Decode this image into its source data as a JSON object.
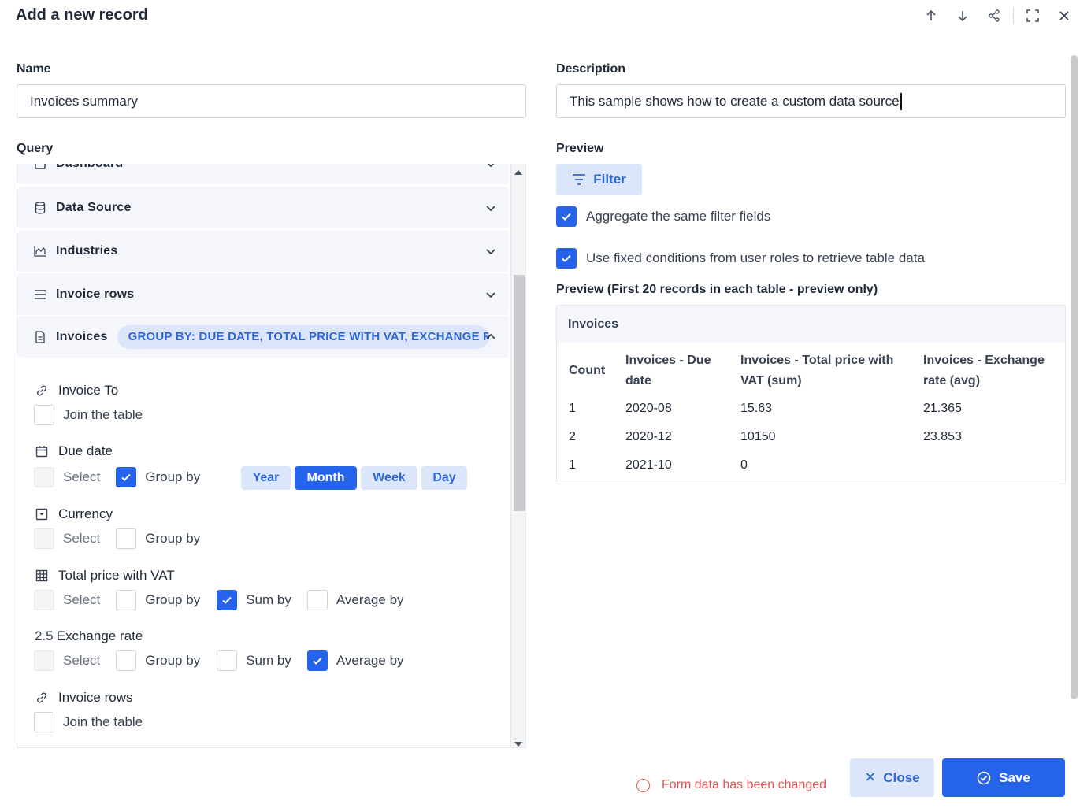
{
  "dialog": {
    "title": "Add a new record"
  },
  "toolbar": [
    "arrow-up-icon",
    "arrow-down-icon",
    "share-icon",
    "fullscreen-icon",
    "close-icon"
  ],
  "form": {
    "name_label": "Name",
    "name_value": "Invoices summary",
    "description_label": "Description",
    "description_value": "This sample shows how to create a custom data source",
    "query_label": "Query",
    "preview_label": "Preview"
  },
  "query": {
    "sections": [
      {
        "label": "Dashboard",
        "icon": "dashboard-icon"
      },
      {
        "label": "Data Source",
        "icon": "database-icon"
      },
      {
        "label": "Industries",
        "icon": "chart-icon"
      },
      {
        "label": "Invoice rows",
        "icon": "list-icon"
      },
      {
        "label": "Invoices",
        "icon": "document-icon",
        "badge": "GROUP BY:  DUE DATE, TOTAL PRICE WITH VAT, EXCHANGE R"
      }
    ],
    "fields": {
      "invoice_to": {
        "label": "Invoice To",
        "icon": "link-icon",
        "join_label": "Join the table"
      },
      "due_date": {
        "label": "Due date",
        "icon": "calendar-icon",
        "select_label": "Select",
        "group_label": "Group by",
        "periods": [
          "Year",
          "Month",
          "Week",
          "Day"
        ],
        "active_period": "Month"
      },
      "currency": {
        "label": "Currency",
        "icon": "dropdown-icon",
        "select_label": "Select",
        "group_label": "Group by"
      },
      "total_price": {
        "label": "Total price with VAT",
        "icon": "table-icon",
        "select_label": "Select",
        "group_label": "Group by",
        "sum_label": "Sum by",
        "avg_label": "Average by"
      },
      "exchange_rate": {
        "label": "Exchange rate",
        "icon_text": "2.5",
        "select_label": "Select",
        "group_label": "Group by",
        "sum_label": "Sum by",
        "avg_label": "Average by"
      },
      "invoice_rows": {
        "label": "Invoice rows",
        "icon": "link-icon",
        "join_label": "Join the table"
      }
    }
  },
  "preview": {
    "filter_label": "Filter",
    "aggregate_label": "Aggregate the same filter fields",
    "fixed_conditions_label": "Use fixed conditions from user roles to retrieve table data",
    "subtitle": "Preview (First 20 records in each table - preview only)",
    "table": {
      "title": "Invoices",
      "columns": [
        "Count",
        "Invoices - Due date",
        "Invoices - Total price with VAT (sum)",
        "Invoices - Exchange rate (avg)"
      ],
      "rows": [
        [
          "1",
          "2020-08",
          "15.63",
          "21.365"
        ],
        [
          "2",
          "2020-12",
          "10150",
          "23.853"
        ],
        [
          "1",
          "2021-10",
          "0",
          ""
        ]
      ]
    }
  },
  "footer": {
    "status": "Form data has been changed",
    "close_label": "Close",
    "save_label": "Save"
  },
  "colors": {
    "accent": "#2563eb",
    "accent_light": "#dbe6fb",
    "status": "#e05252"
  }
}
